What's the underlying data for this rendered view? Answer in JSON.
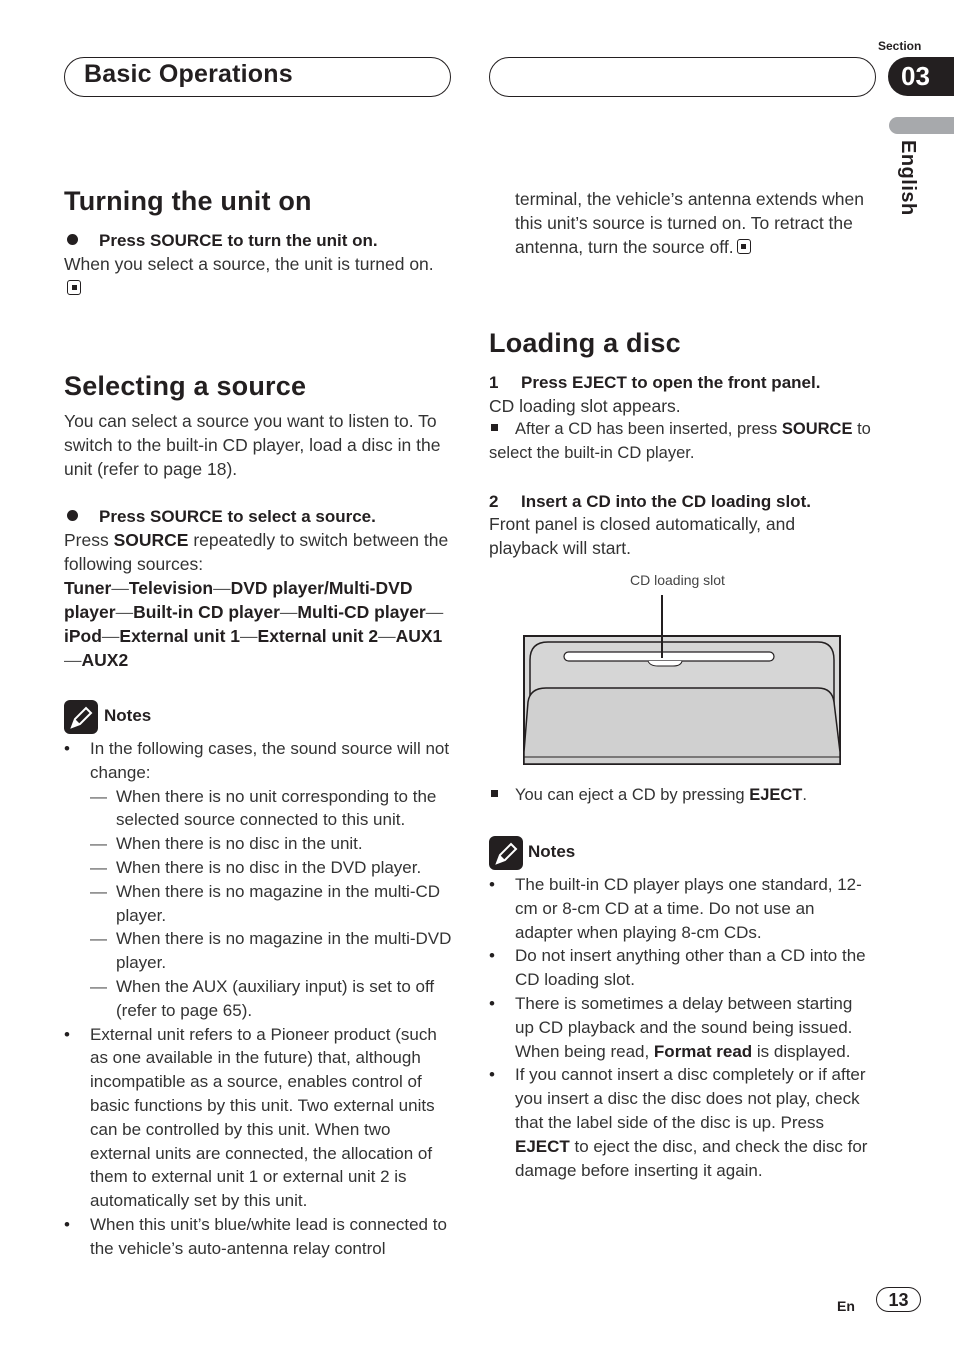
{
  "header": {
    "title": "Basic Operations",
    "section_label": "Section",
    "section_number": "03",
    "language": "English"
  },
  "turning_on": {
    "heading": "Turning the unit on",
    "step": "Press SOURCE to turn the unit on.",
    "body": "When you select a source, the unit is turned on."
  },
  "selecting": {
    "heading": "Selecting a source",
    "intro": "You can select a source you want to listen to. To switch to the built-in CD player, load a disc in the unit (refer to page 18).",
    "step": "Press SOURCE to select a source.",
    "body_prefix": "Press ",
    "body_bold": "SOURCE",
    "body_suffix": " repeatedly to switch between the following sources:",
    "sources": [
      "Tuner",
      "Television",
      "DVD player/Multi-DVD player",
      "Built-in CD player",
      "Multi-CD player",
      "iPod",
      "External unit 1",
      "External unit 2",
      "AUX1",
      "AUX2"
    ],
    "notes_label": "Notes",
    "notes": [
      {
        "text": "In the following cases, the sound source will not change:",
        "sub": [
          "When there is no unit corresponding to the selected source connected to this unit.",
          "When there is no disc in the unit.",
          "When there is no disc in the DVD player.",
          "When there is no magazine in the multi-CD player.",
          "When there is no magazine in the multi-DVD player.",
          "When the AUX (auxiliary input) is set to off (refer to page 65)."
        ]
      },
      {
        "text": "External unit refers to a Pioneer product (such as one available in the future) that, although incompatible as a source, enables control of basic functions by this unit. Two external units can be controlled by this unit. When two external units are connected, the allocation of them to external unit 1 or external unit 2 is automatically set by this unit."
      },
      {
        "text": "When this unit’s blue/white lead is connected to the vehicle’s auto-antenna relay control"
      }
    ],
    "continued": "terminal, the vehicle’s antenna extends when this unit’s source is turned on. To retract the antenna, turn the source off."
  },
  "loading": {
    "heading": "Loading a disc",
    "step1_num": "1",
    "step1": "Press EJECT to open the front panel.",
    "step1_body": "CD loading slot appears.",
    "step1_note_prefix": "After a CD has been inserted, press ",
    "step1_note_bold": "SOURCE",
    "step1_note_suffix": " to select the built-in CD player.",
    "step2_num": "2",
    "step2": "Insert a CD into the CD loading slot.",
    "step2_body": "Front panel is closed automatically, and playback will start.",
    "figure_label": "CD loading slot",
    "eject_note_prefix": "You can eject a CD by pressing ",
    "eject_note_bold": "EJECT",
    "eject_note_suffix": ".",
    "notes_label": "Notes",
    "note1": "The built-in CD player plays one standard, 12-cm or 8-cm CD at a time. Do not use an adapter when playing 8-cm CDs.",
    "note2": "Do not insert anything other than a CD into the CD loading slot.",
    "note3_prefix": "There is sometimes a delay between starting up CD playback and the sound being issued. When being read, ",
    "note3_bold": "Format read",
    "note3_suffix": " is displayed.",
    "note4_prefix": "If you cannot insert a disc completely or if after you insert a disc the disc does not play, check that the label side of the disc is up. Press ",
    "note4_bold": "EJECT",
    "note4_suffix": " to eject the disc, and check the disc for damage before inserting it again."
  },
  "footer": {
    "lang_code": "En",
    "page_number": "13"
  }
}
